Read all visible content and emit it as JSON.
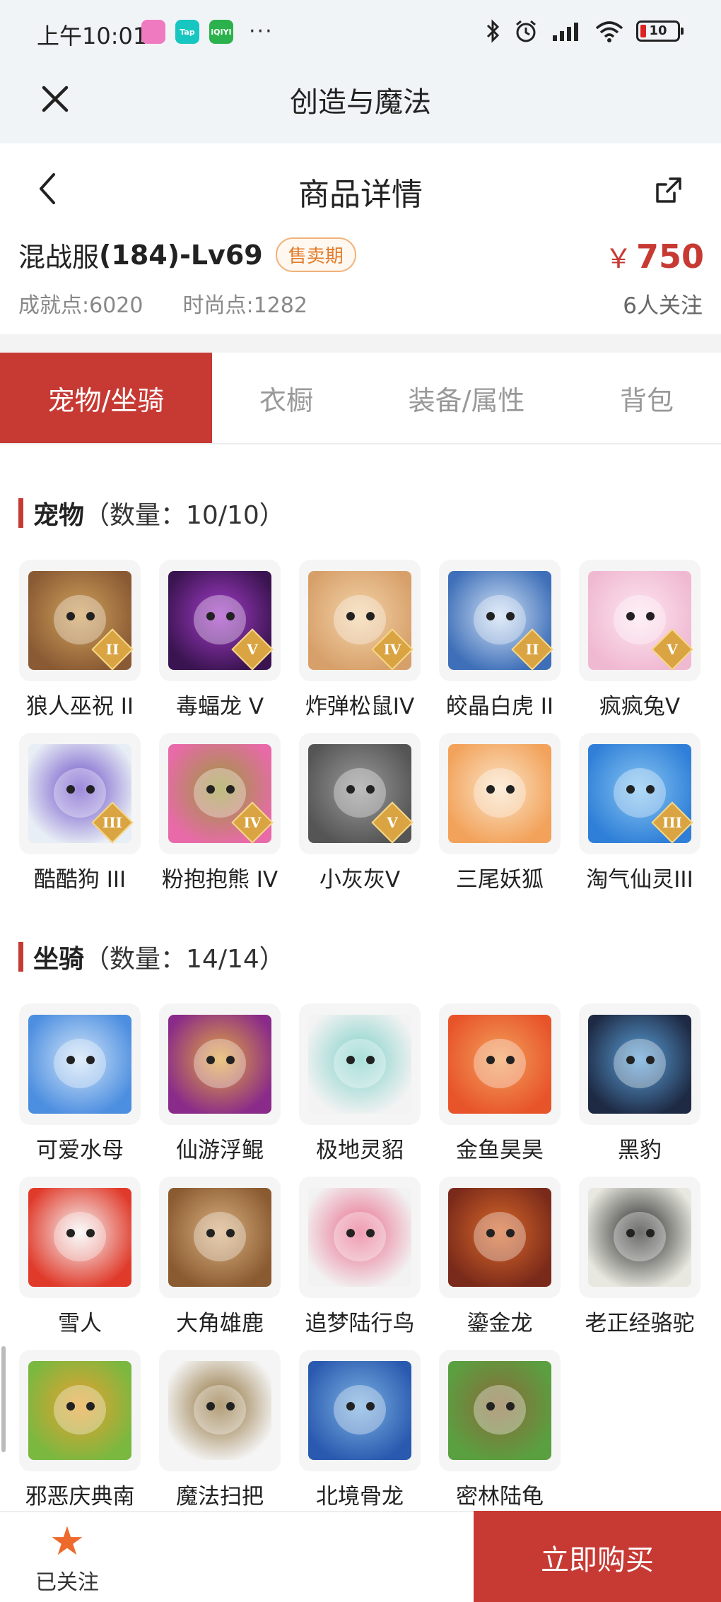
{
  "status_bar": {
    "time": "上午10:01",
    "apps": [
      {
        "icon": "game-app-icon",
        "text": "",
        "color": "#f07ac0"
      },
      {
        "icon": "taptap-icon",
        "text": "Tap",
        "color": "#17c6c0"
      },
      {
        "icon": "iqiyi-icon",
        "text": "iQIYI",
        "color": "#2bb24c"
      }
    ],
    "more": "···",
    "battery": "10"
  },
  "app_bar": {
    "title": "创造与魔法"
  },
  "detail_bar": {
    "title": "商品详情"
  },
  "listing": {
    "server_prefix": "混战服",
    "server_bold": "(184)-Lv69",
    "badge": "售卖期",
    "price_symbol": "￥",
    "price": "750",
    "achievement_label": "成就点:",
    "achievement_value": "6020",
    "fashion_label": "时尚点:",
    "fashion_value": "1282",
    "followers": "6人关注"
  },
  "tabs": [
    {
      "label": "宠物/坐骑",
      "active": true
    },
    {
      "label": "衣橱",
      "active": false
    },
    {
      "label": "装备/属性",
      "active": false
    },
    {
      "label": "背包",
      "active": false
    }
  ],
  "pets_section": {
    "title": "宠物",
    "count": "（数量：10/10）",
    "items": [
      {
        "name": "狼人巫祝 II",
        "rank": "II",
        "colors": [
          "#8a5a34",
          "#cfa15a"
        ]
      },
      {
        "name": "毒蝠龙 V",
        "rank": "V",
        "colors": [
          "#3a1450",
          "#a33cc8"
        ]
      },
      {
        "name": "炸弹松鼠IV",
        "rank": "IV",
        "colors": [
          "#d7a06a",
          "#f3d3a8"
        ]
      },
      {
        "name": "皎晶白虎 II",
        "rank": "II",
        "colors": [
          "#3e6fb8",
          "#cfe0f5"
        ]
      },
      {
        "name": "疯疯兔V",
        "rank": "V",
        "colors": [
          "#f0b9d2",
          "#fde6f0"
        ]
      },
      {
        "name": "酷酷狗 III",
        "rank": "III",
        "colors": [
          "#e8eef5",
          "#6a4cc8"
        ]
      },
      {
        "name": "粉抱抱熊 IV",
        "rank": "IV",
        "colors": [
          "#e86aa8",
          "#9a9a3a"
        ]
      },
      {
        "name": "小灰灰V",
        "rank": "V",
        "colors": [
          "#555555",
          "#9a9a9a"
        ]
      },
      {
        "name": "三尾妖狐",
        "rank": "",
        "colors": [
          "#f2a25a",
          "#fbe3c5"
        ]
      },
      {
        "name": "淘气仙灵III",
        "rank": "III",
        "colors": [
          "#2f7fd8",
          "#86c5f2"
        ]
      }
    ]
  },
  "mounts_section": {
    "title": "坐骑",
    "count": "（数量：14/14）",
    "items": [
      {
        "name": "可爱水母",
        "colors": [
          "#4c8ee0",
          "#cfe4f8"
        ]
      },
      {
        "name": "仙游浮鲲",
        "colors": [
          "#8a2a8a",
          "#e0a640"
        ]
      },
      {
        "name": "极地灵貂",
        "colors": [
          "#f3f3f3",
          "#7fd0c8"
        ]
      },
      {
        "name": "金鱼昊昊",
        "colors": [
          "#e8542a",
          "#f2a05a"
        ]
      },
      {
        "name": "黑豹",
        "colors": [
          "#1e2a44",
          "#5aa0d8"
        ]
      },
      {
        "name": "雪人",
        "colors": [
          "#e03a2a",
          "#f7f7f7"
        ]
      },
      {
        "name": "大角雄鹿",
        "colors": [
          "#8a5a30",
          "#d9b080"
        ]
      },
      {
        "name": "追梦陆行鸟",
        "colors": [
          "#f2f2f2",
          "#e86a8a"
        ]
      },
      {
        "name": "鎏金龙",
        "colors": [
          "#7a2a1a",
          "#d8682a"
        ]
      },
      {
        "name": "老正经骆驼",
        "colors": [
          "#e8e8e0",
          "#222222"
        ]
      },
      {
        "name": "邪恶庆典南",
        "colors": [
          "#7ab840",
          "#e8a030"
        ]
      },
      {
        "name": "魔法扫把",
        "colors": [
          "#f5f5f5",
          "#8a6a30"
        ]
      },
      {
        "name": "北境骨龙",
        "colors": [
          "#2a5ab0",
          "#7ab0e0"
        ]
      },
      {
        "name": "密林陆龟",
        "colors": [
          "#5aa040",
          "#8a6a3a"
        ]
      }
    ]
  },
  "bottom_bar": {
    "follow_label": "已关注",
    "buy_label": "立即购买"
  }
}
